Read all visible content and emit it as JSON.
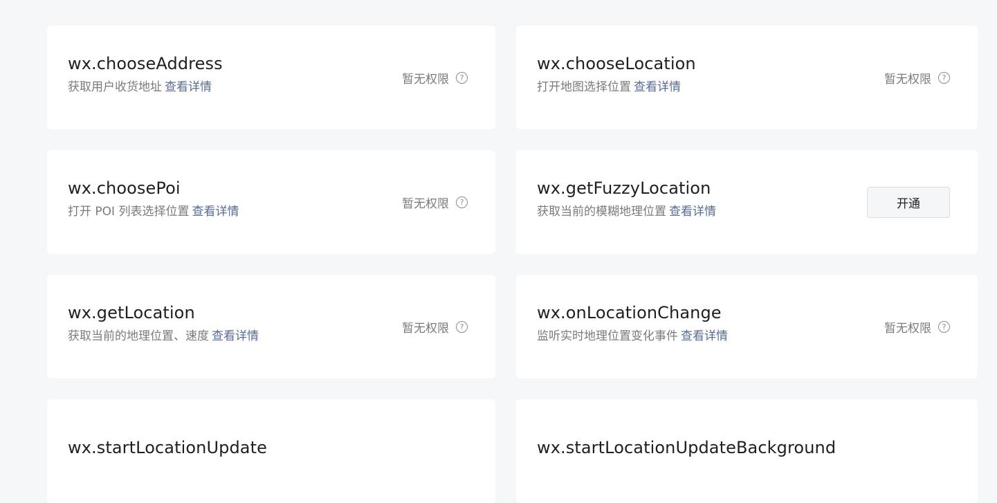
{
  "detail_link_label": "查看详情",
  "no_permission_label": "暂无权限",
  "help_glyph": "?",
  "cards": [
    {
      "name": "wx.chooseAddress",
      "desc": "获取用户收货地址",
      "action": "status"
    },
    {
      "name": "wx.chooseLocation",
      "desc": "打开地图选择位置",
      "action": "status"
    },
    {
      "name": "wx.choosePoi",
      "desc": "打开 POI 列表选择位置",
      "action": "status"
    },
    {
      "name": "wx.getFuzzyLocation",
      "desc": "获取当前的模糊地理位置",
      "action": "button",
      "button_label": "开通"
    },
    {
      "name": "wx.getLocation",
      "desc": "获取当前的地理位置、速度",
      "action": "status"
    },
    {
      "name": "wx.onLocationChange",
      "desc": "监听实时地理位置变化事件",
      "action": "status"
    },
    {
      "name": "wx.startLocationUpdate",
      "desc": "",
      "action": "none"
    },
    {
      "name": "wx.startLocationUpdateBackground",
      "desc": "",
      "action": "none"
    }
  ],
  "colors": {
    "page_background": "#f6f7f9",
    "card_background": "#ffffff",
    "link": "#576b95",
    "secondary_text": "#7a7a7a"
  }
}
